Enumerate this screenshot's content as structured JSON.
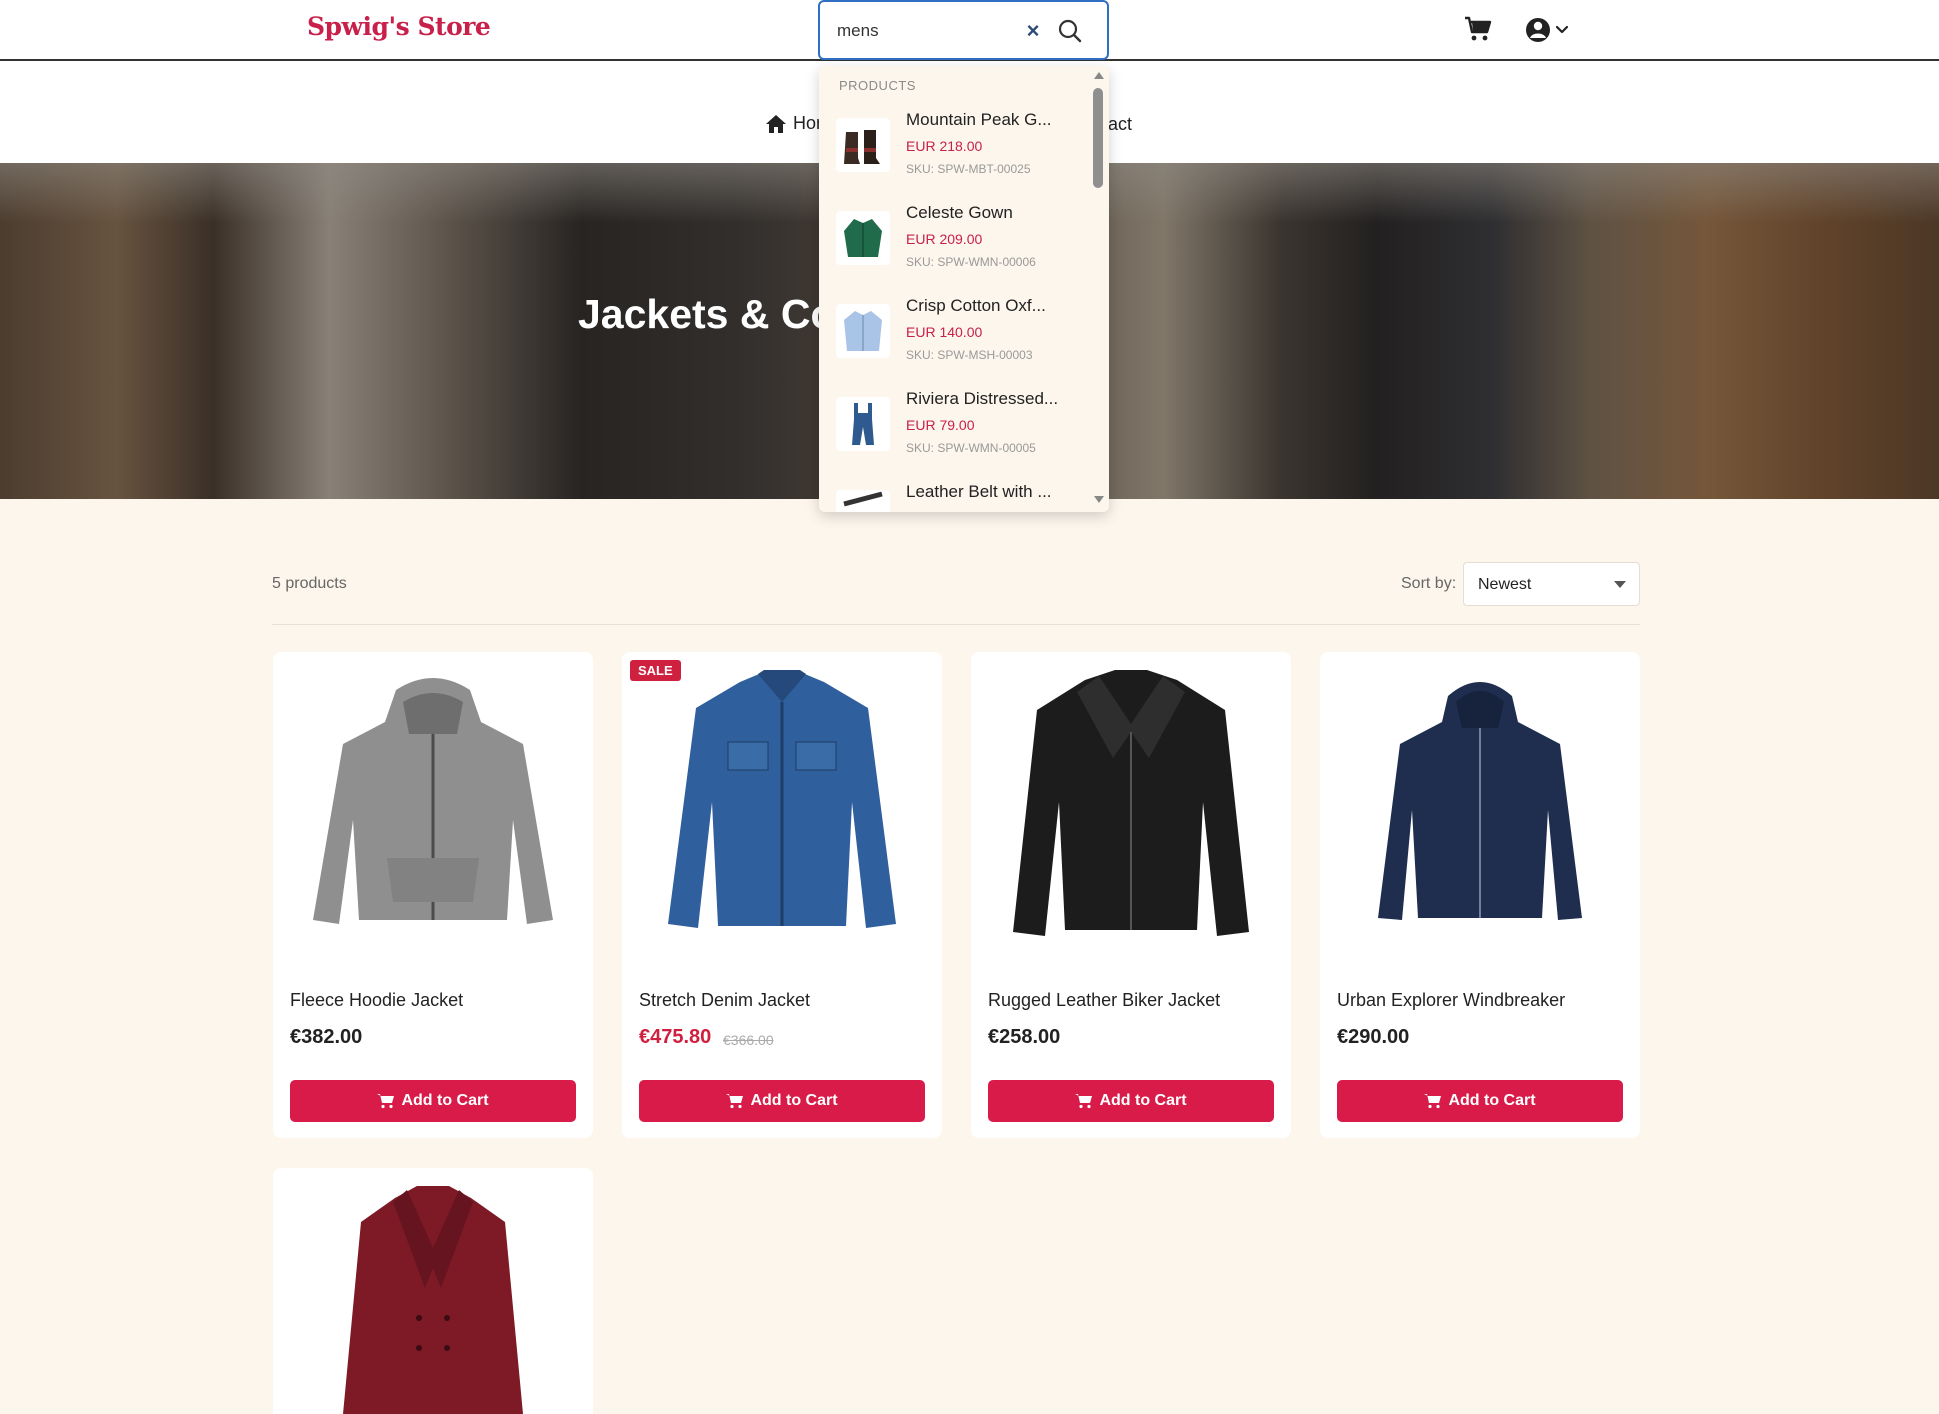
{
  "store": {
    "name": "Spwig's Store"
  },
  "search": {
    "query": "mens",
    "placeholder": ""
  },
  "nav": {
    "home_label": "Home",
    "contact_label": "Contact"
  },
  "hero": {
    "title": "Jackets & Coats"
  },
  "dropdown": {
    "heading": "PRODUCTS",
    "items": [
      {
        "name": "Mountain Peak G...",
        "price": "EUR 218.00",
        "sku": "SKU: SPW-MBT-00025",
        "icon": "boots"
      },
      {
        "name": "Celeste Gown",
        "price": "EUR 209.00",
        "sku": "SKU: SPW-WMN-00006",
        "icon": "green-blouse"
      },
      {
        "name": "Crisp Cotton Oxf...",
        "price": "EUR 140.00",
        "sku": "SKU: SPW-MSH-00003",
        "icon": "light-blue-shirt"
      },
      {
        "name": "Riviera Distressed...",
        "price": "EUR 79.00",
        "sku": "SKU: SPW-WMN-00005",
        "icon": "denim-overalls"
      },
      {
        "name": "Leather Belt with ...",
        "price": "",
        "sku": "",
        "icon": "belt"
      }
    ]
  },
  "listing": {
    "count": "5 products",
    "sort_label": "Sort by:",
    "sort_value": "Newest",
    "add_label": "Add to Cart",
    "sale_label": "SALE",
    "products": [
      {
        "name": "Fleece Hoodie Jacket",
        "price": "€382.00",
        "old_price": "",
        "on_sale": false,
        "color": "#8f8f8f"
      },
      {
        "name": "Stretch Denim Jacket",
        "price": "€475.80",
        "old_price": "€366.00",
        "on_sale": true,
        "color": "#2f5f9c"
      },
      {
        "name": "Rugged Leather Biker Jacket",
        "price": "€258.00",
        "old_price": "",
        "on_sale": false,
        "color": "#1c1c1c"
      },
      {
        "name": "Urban Explorer Windbreaker",
        "price": "€290.00",
        "old_price": "",
        "on_sale": false,
        "color": "#1f2d4f"
      },
      {
        "name": "",
        "price": "",
        "old_price": "",
        "on_sale": false,
        "color": "#7d1a26"
      }
    ]
  },
  "colors": {
    "brand": "#c8204a",
    "button": "#d81b48",
    "background": "#fdf6ec",
    "search_border": "#2f6fc4"
  }
}
